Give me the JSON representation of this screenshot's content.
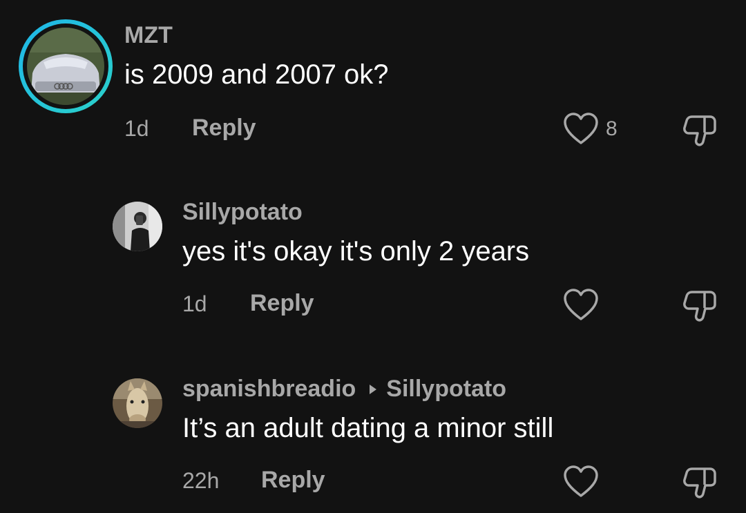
{
  "comments": [
    {
      "username": "MZT",
      "text": "is 2009 and 2007 ok?",
      "time": "1d",
      "reply_label": "Reply",
      "likes": "8",
      "avatar_icon": "car-photo-avatar"
    },
    {
      "username": "Sillypotato",
      "text": "yes it's okay it's only 2 years",
      "time": "1d",
      "reply_label": "Reply",
      "likes": "",
      "avatar_icon": "mirror-selfie-avatar"
    },
    {
      "username": "spanishbreadio",
      "reply_to": "Sillypotato",
      "text": "It’s an adult dating a minor still",
      "time": "22h",
      "reply_label": "Reply",
      "likes": "",
      "avatar_icon": "horse-photo-avatar"
    }
  ],
  "colors": {
    "background": "#121212",
    "text_primary": "#ffffff",
    "text_secondary": "#a8a8a8",
    "story_ring_start": "#1fb6e8",
    "story_ring_end": "#2bd1c9"
  }
}
